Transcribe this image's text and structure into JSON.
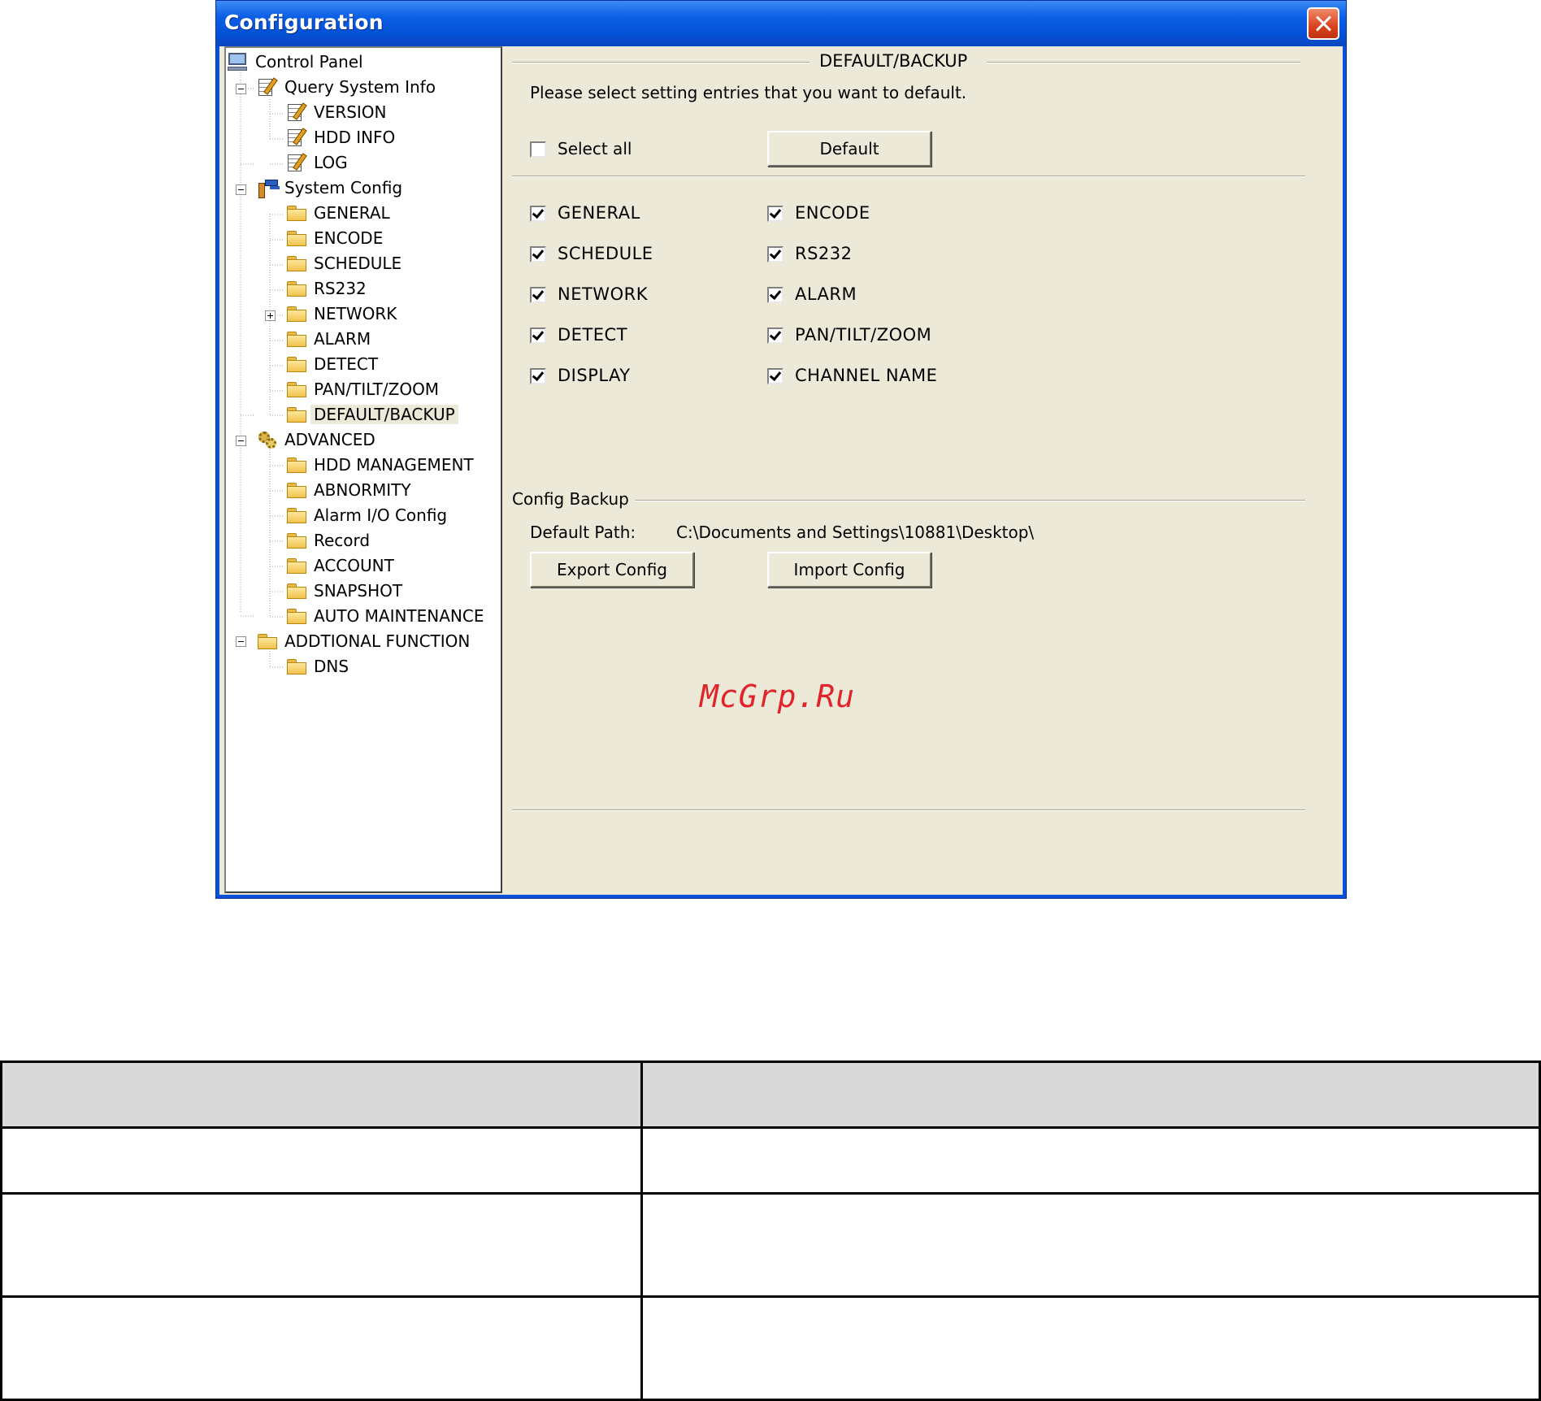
{
  "window": {
    "title": "Configuration",
    "close_icon": "close-icon"
  },
  "tree": {
    "nodes": [
      {
        "label": "Control Panel",
        "icon": "computer-icon"
      },
      {
        "label": "Query System Info",
        "icon": "notepad-icon"
      },
      {
        "label": "VERSION",
        "icon": "notepad-icon"
      },
      {
        "label": "HDD INFO",
        "icon": "notepad-icon"
      },
      {
        "label": "LOG",
        "icon": "notepad-icon"
      },
      {
        "label": "System Config",
        "icon": "tools-icon"
      },
      {
        "label": "GENERAL",
        "icon": "folder-icon"
      },
      {
        "label": "ENCODE",
        "icon": "folder-icon"
      },
      {
        "label": "SCHEDULE",
        "icon": "folder-icon"
      },
      {
        "label": "RS232",
        "icon": "folder-icon"
      },
      {
        "label": "NETWORK",
        "icon": "folder-icon"
      },
      {
        "label": "ALARM",
        "icon": "folder-icon"
      },
      {
        "label": "DETECT",
        "icon": "folder-icon"
      },
      {
        "label": "PAN/TILT/ZOOM",
        "icon": "folder-icon"
      },
      {
        "label": "DEFAULT/BACKUP",
        "icon": "folder-open-icon"
      },
      {
        "label": "ADVANCED",
        "icon": "gears-icon"
      },
      {
        "label": "HDD MANAGEMENT",
        "icon": "folder-icon"
      },
      {
        "label": "ABNORMITY",
        "icon": "folder-icon"
      },
      {
        "label": "Alarm I/O Config",
        "icon": "folder-icon"
      },
      {
        "label": "Record",
        "icon": "folder-icon"
      },
      {
        "label": "ACCOUNT",
        "icon": "folder-icon"
      },
      {
        "label": "SNAPSHOT",
        "icon": "folder-icon"
      },
      {
        "label": "AUTO MAINTENANCE",
        "icon": "folder-icon"
      },
      {
        "label": "ADDTIONAL FUNCTION",
        "icon": "folder-icon"
      },
      {
        "label": "DNS",
        "icon": "folder-icon"
      }
    ],
    "selected": "DEFAULT/BACKUP"
  },
  "default_section": {
    "title": "DEFAULT/BACKUP",
    "instruction": "Please select setting entries that you want to default.",
    "select_all_label": "Select all",
    "select_all_checked": false,
    "default_button": "Default",
    "entries": [
      {
        "label": "GENERAL",
        "checked": true
      },
      {
        "label": "ENCODE",
        "checked": true
      },
      {
        "label": "SCHEDULE",
        "checked": true
      },
      {
        "label": "RS232",
        "checked": true
      },
      {
        "label": "NETWORK",
        "checked": true
      },
      {
        "label": "ALARM",
        "checked": true
      },
      {
        "label": "DETECT",
        "checked": true
      },
      {
        "label": "PAN/TILT/ZOOM",
        "checked": true
      },
      {
        "label": "DISPLAY",
        "checked": true
      },
      {
        "label": "CHANNEL NAME",
        "checked": true
      }
    ]
  },
  "backup_section": {
    "title": "Config Backup",
    "path_label": "Default Path:",
    "path_value": "C:\\Documents and Settings\\10881\\Desktop\\",
    "export_button": "Export Config",
    "import_button": "Import Config"
  },
  "watermark": "McGrp.Ru",
  "table": {
    "header": [
      "",
      ""
    ],
    "rows": [
      [
        "",
        ""
      ],
      [
        "",
        ""
      ],
      [
        "",
        ""
      ]
    ]
  }
}
